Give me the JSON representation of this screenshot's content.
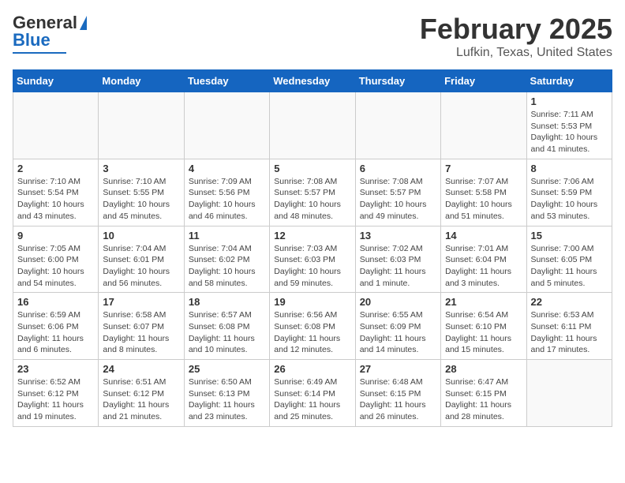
{
  "header": {
    "logo_general": "General",
    "logo_blue": "Blue",
    "title": "February 2025",
    "subtitle": "Lufkin, Texas, United States"
  },
  "days_of_week": [
    "Sunday",
    "Monday",
    "Tuesday",
    "Wednesday",
    "Thursday",
    "Friday",
    "Saturday"
  ],
  "weeks": [
    [
      {
        "day": "",
        "info": ""
      },
      {
        "day": "",
        "info": ""
      },
      {
        "day": "",
        "info": ""
      },
      {
        "day": "",
        "info": ""
      },
      {
        "day": "",
        "info": ""
      },
      {
        "day": "",
        "info": ""
      },
      {
        "day": "1",
        "info": "Sunrise: 7:11 AM\nSunset: 5:53 PM\nDaylight: 10 hours and 41 minutes."
      }
    ],
    [
      {
        "day": "2",
        "info": "Sunrise: 7:10 AM\nSunset: 5:54 PM\nDaylight: 10 hours and 43 minutes."
      },
      {
        "day": "3",
        "info": "Sunrise: 7:10 AM\nSunset: 5:55 PM\nDaylight: 10 hours and 45 minutes."
      },
      {
        "day": "4",
        "info": "Sunrise: 7:09 AM\nSunset: 5:56 PM\nDaylight: 10 hours and 46 minutes."
      },
      {
        "day": "5",
        "info": "Sunrise: 7:08 AM\nSunset: 5:57 PM\nDaylight: 10 hours and 48 minutes."
      },
      {
        "day": "6",
        "info": "Sunrise: 7:08 AM\nSunset: 5:57 PM\nDaylight: 10 hours and 49 minutes."
      },
      {
        "day": "7",
        "info": "Sunrise: 7:07 AM\nSunset: 5:58 PM\nDaylight: 10 hours and 51 minutes."
      },
      {
        "day": "8",
        "info": "Sunrise: 7:06 AM\nSunset: 5:59 PM\nDaylight: 10 hours and 53 minutes."
      }
    ],
    [
      {
        "day": "9",
        "info": "Sunrise: 7:05 AM\nSunset: 6:00 PM\nDaylight: 10 hours and 54 minutes."
      },
      {
        "day": "10",
        "info": "Sunrise: 7:04 AM\nSunset: 6:01 PM\nDaylight: 10 hours and 56 minutes."
      },
      {
        "day": "11",
        "info": "Sunrise: 7:04 AM\nSunset: 6:02 PM\nDaylight: 10 hours and 58 minutes."
      },
      {
        "day": "12",
        "info": "Sunrise: 7:03 AM\nSunset: 6:03 PM\nDaylight: 10 hours and 59 minutes."
      },
      {
        "day": "13",
        "info": "Sunrise: 7:02 AM\nSunset: 6:03 PM\nDaylight: 11 hours and 1 minute."
      },
      {
        "day": "14",
        "info": "Sunrise: 7:01 AM\nSunset: 6:04 PM\nDaylight: 11 hours and 3 minutes."
      },
      {
        "day": "15",
        "info": "Sunrise: 7:00 AM\nSunset: 6:05 PM\nDaylight: 11 hours and 5 minutes."
      }
    ],
    [
      {
        "day": "16",
        "info": "Sunrise: 6:59 AM\nSunset: 6:06 PM\nDaylight: 11 hours and 6 minutes."
      },
      {
        "day": "17",
        "info": "Sunrise: 6:58 AM\nSunset: 6:07 PM\nDaylight: 11 hours and 8 minutes."
      },
      {
        "day": "18",
        "info": "Sunrise: 6:57 AM\nSunset: 6:08 PM\nDaylight: 11 hours and 10 minutes."
      },
      {
        "day": "19",
        "info": "Sunrise: 6:56 AM\nSunset: 6:08 PM\nDaylight: 11 hours and 12 minutes."
      },
      {
        "day": "20",
        "info": "Sunrise: 6:55 AM\nSunset: 6:09 PM\nDaylight: 11 hours and 14 minutes."
      },
      {
        "day": "21",
        "info": "Sunrise: 6:54 AM\nSunset: 6:10 PM\nDaylight: 11 hours and 15 minutes."
      },
      {
        "day": "22",
        "info": "Sunrise: 6:53 AM\nSunset: 6:11 PM\nDaylight: 11 hours and 17 minutes."
      }
    ],
    [
      {
        "day": "23",
        "info": "Sunrise: 6:52 AM\nSunset: 6:12 PM\nDaylight: 11 hours and 19 minutes."
      },
      {
        "day": "24",
        "info": "Sunrise: 6:51 AM\nSunset: 6:12 PM\nDaylight: 11 hours and 21 minutes."
      },
      {
        "day": "25",
        "info": "Sunrise: 6:50 AM\nSunset: 6:13 PM\nDaylight: 11 hours and 23 minutes."
      },
      {
        "day": "26",
        "info": "Sunrise: 6:49 AM\nSunset: 6:14 PM\nDaylight: 11 hours and 25 minutes."
      },
      {
        "day": "27",
        "info": "Sunrise: 6:48 AM\nSunset: 6:15 PM\nDaylight: 11 hours and 26 minutes."
      },
      {
        "day": "28",
        "info": "Sunrise: 6:47 AM\nSunset: 6:15 PM\nDaylight: 11 hours and 28 minutes."
      },
      {
        "day": "",
        "info": ""
      }
    ]
  ]
}
